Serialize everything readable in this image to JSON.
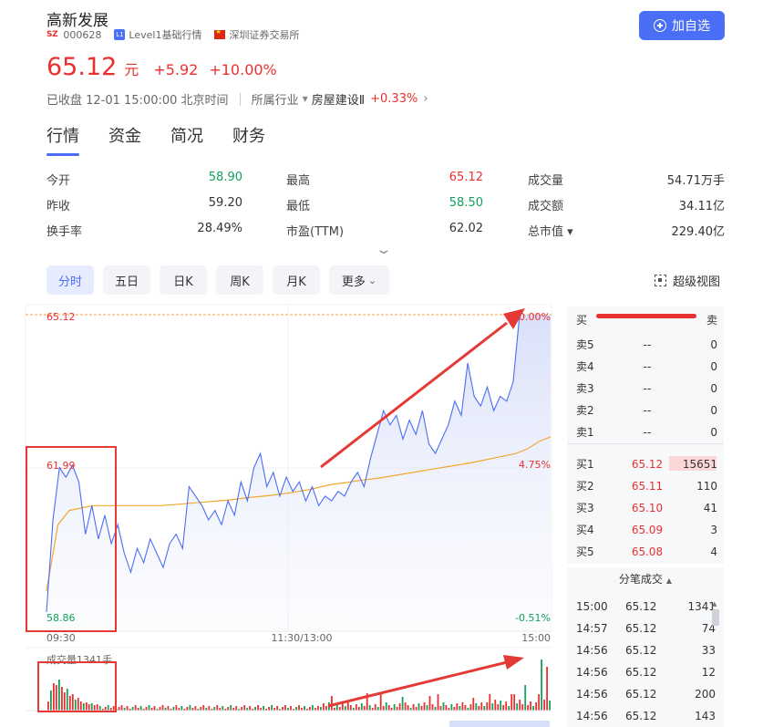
{
  "header": {
    "name": "高新发展",
    "exchange_badge": "SZ",
    "code": "000628",
    "level_badge": "L1",
    "level_text": "Level1基础行情",
    "exchange_name": "深圳证券交易所",
    "price": "65.12",
    "unit": "元",
    "change": "+5.92",
    "change_pct": "+10.00%",
    "status": "已收盘 12-01 15:00:00 北京时间",
    "industry_label": "所属行业",
    "industry_name": "房屋建设Ⅱ",
    "industry_pct": "+0.33%",
    "add_button": "加自选"
  },
  "tabs": [
    {
      "label": "行情",
      "active": true
    },
    {
      "label": "资金",
      "active": false
    },
    {
      "label": "简况",
      "active": false
    },
    {
      "label": "财务",
      "active": false
    }
  ],
  "quote": [
    [
      {
        "label": "今开",
        "value": "58.90",
        "color": "green"
      },
      {
        "label": "最高",
        "value": "65.12",
        "color": "red"
      },
      {
        "label": "成交量",
        "value": "54.71万手",
        "color": "plain"
      }
    ],
    [
      {
        "label": "昨收",
        "value": "59.20",
        "color": "plain"
      },
      {
        "label": "最低",
        "value": "58.50",
        "color": "green"
      },
      {
        "label": "成交额",
        "value": "34.11亿",
        "color": "plain"
      }
    ],
    [
      {
        "label": "换手率",
        "value": "28.49%",
        "color": "plain"
      },
      {
        "label": "市盈(TTM)",
        "value": "62.02",
        "color": "plain"
      },
      {
        "label": "总市值 ▾",
        "value": "229.40亿",
        "color": "plain"
      }
    ]
  ],
  "period_tabs": [
    {
      "label": "分时",
      "active": true
    },
    {
      "label": "五日",
      "active": false
    },
    {
      "label": "日K",
      "active": false
    },
    {
      "label": "周K",
      "active": false
    },
    {
      "label": "月K",
      "active": false
    },
    {
      "label": "更多",
      "active": false
    }
  ],
  "super_view": "超级视图",
  "chart": {
    "price_high": "65.12",
    "price_mid": "61.99",
    "price_low": "58.86",
    "pct_high": "10.00%",
    "pct_mid": "4.75%",
    "pct_low": "-0.51%",
    "time_start": "09:30",
    "time_mid": "11:30/13:00",
    "time_end": "15:00",
    "volume_label": "成交量1341手"
  },
  "chart_data": {
    "type": "line",
    "x_range": [
      "09:30",
      "15:00"
    ],
    "ylim": [
      58.86,
      65.12
    ],
    "series": [],
    "price": [
      58.86,
      60.8,
      61.9,
      61.7,
      61.95,
      61.6,
      60.5,
      61.1,
      60.4,
      60.9,
      60.3,
      60.7,
      60.1,
      59.7,
      60.2,
      59.9,
      60.4,
      60.1,
      59.8,
      60.3,
      60.5,
      60.2,
      61.5,
      61.3,
      61.1,
      60.8,
      61.0,
      60.7,
      61.2,
      60.9,
      61.6,
      61.2,
      61.9,
      62.2,
      61.5,
      61.8,
      61.3,
      61.7,
      61.4,
      61.6,
      61.2,
      61.5,
      61.1,
      61.3,
      61.2,
      61.4,
      61.3,
      61.6,
      61.8,
      61.5,
      62.1,
      62.6,
      63.1,
      62.8,
      63.0,
      62.5,
      62.9,
      62.6,
      63.1,
      62.4,
      62.2,
      62.5,
      62.8,
      63.3,
      63.0,
      64.1,
      63.4,
      63.2,
      63.6,
      63.1,
      63.4,
      63.3,
      63.7,
      65.12
    ],
    "avg": [
      59.3,
      60.7,
      61.0,
      61.05,
      61.1,
      61.1,
      61.1,
      61.1,
      61.1,
      61.1,
      61.1,
      61.12,
      61.14,
      61.16,
      61.18,
      61.2,
      61.22,
      61.25,
      61.28,
      61.3,
      61.33,
      61.36,
      61.4,
      61.44,
      61.5,
      61.55,
      61.58,
      61.62,
      61.65,
      61.68,
      61.72,
      61.76,
      61.8,
      61.84,
      61.88,
      61.92,
      61.96,
      62.0,
      62.05,
      62.1,
      62.15,
      62.2,
      62.3,
      62.45,
      62.55
    ],
    "volume_max": 1341
  }
}
